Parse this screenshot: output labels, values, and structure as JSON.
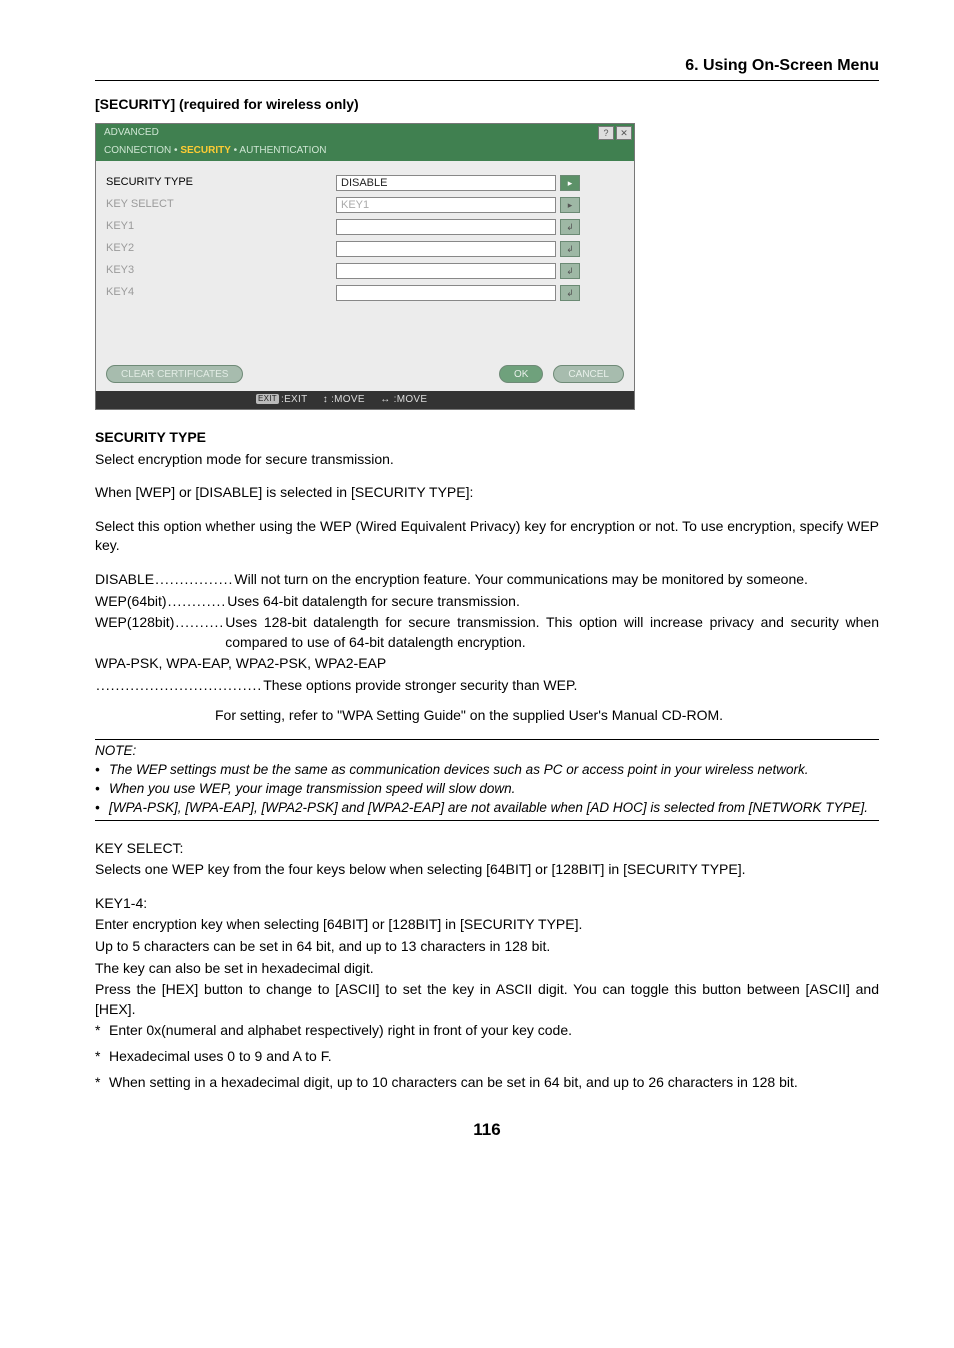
{
  "sectionHeader": "6. Using On-Screen Menu",
  "subsectionTitle": "[SECURITY] (required for wireless only)",
  "osd": {
    "title": "ADVANCED",
    "tabs": {
      "t1": "CONNECTION",
      "t2": "SECURITY",
      "t3": "AUTHENTICATION",
      "bullet": "•"
    },
    "rows": {
      "secTypeLabel": "SECURITY TYPE",
      "secTypeValue": "DISABLE",
      "keySelectLabel": "KEY SELECT",
      "keySelectValue": "KEY1",
      "key1Label": "KEY1",
      "key2Label": "KEY2",
      "key3Label": "KEY3",
      "key4Label": "KEY4"
    },
    "buttons": {
      "clear": "CLEAR CERTIFICATES",
      "ok": "OK",
      "cancel": "CANCEL"
    },
    "footer": {
      "exitKey": "EXIT",
      "exit": ":EXIT",
      "move1": "↕ :MOVE",
      "move2": "↔ :MOVE"
    },
    "icons": {
      "help": "?",
      "close": "✕",
      "right": "▸",
      "enter": "↲"
    }
  },
  "body": {
    "secTypeHeading": "SECURITY TYPE",
    "secTypeLine": "Select encryption mode for secure transmission.",
    "whenLine": "When [WEP] or [DISABLE] is selected in [SECURITY TYPE]:",
    "selectOption": "Select this option whether using the WEP (Wired Equivalent Privacy) key for encryption or not. To use encryption, specify WEP key.",
    "defs": {
      "disableTerm": "DISABLE",
      "disableDots": "................",
      "disableDesc": "Will not turn on the encryption feature. Your communications may be monitored by someone.",
      "wep64Term": "WEP(64bit)",
      "wep64Dots": "............",
      "wep64Desc": "Uses 64-bit datalength for secure transmission.",
      "wep128Term": "WEP(128bit)",
      "wep128Dots": "..........",
      "wep128Desc": "Uses 128-bit datalength for secure transmission. This option will increase privacy and security when compared to use of 64-bit datalength encryption.",
      "wpaTerm": "WPA-PSK, WPA-EAP, WPA2-PSK, WPA2-EAP",
      "wpaDots": "..................................",
      "wpaDesc": "These options provide stronger security than WEP.",
      "wpaSetting": "For setting, refer to \"WPA Setting Guide\" on the supplied User's Manual CD-ROM."
    },
    "note": {
      "head": "NOTE:",
      "li1": "The WEP settings must be the same as communication devices such as PC or access point in your wireless network.",
      "li2": "When you use WEP, your image transmission speed will slow down.",
      "li3": "[WPA-PSK], [WPA-EAP], [WPA2-PSK] and [WPA2-EAP] are not available when [AD HOC] is selected from [NETWORK TYPE].",
      "bullet": "•"
    },
    "keySelect": {
      "head": "KEY SELECT:",
      "line": "Selects one WEP key from the four keys below when selecting [64BIT] or [128BIT] in [SECURITY TYPE]."
    },
    "key14": {
      "head": "KEY1-4:",
      "l1": "Enter encryption key when selecting [64BIT] or [128BIT] in [SECURITY TYPE].",
      "l2": "Up to 5 characters can be set in 64 bit, and up to 13 characters in 128 bit.",
      "l3": "The key can also be set in hexadecimal digit.",
      "l4": "Press the [HEX] button to change to [ASCII] to set the key in ASCII digit. You can toggle this button between [ASCII] and [HEX].",
      "s1": "Enter 0x(numeral and alphabet respectively) right in front of your key code.",
      "s2": "Hexadecimal uses 0 to 9 and A to F.",
      "s3": "When setting in a hexadecimal digit, up to 10 characters can be set in 64 bit, and up to 26 characters in 128 bit.",
      "star": "*"
    }
  },
  "pageNumber": "116"
}
